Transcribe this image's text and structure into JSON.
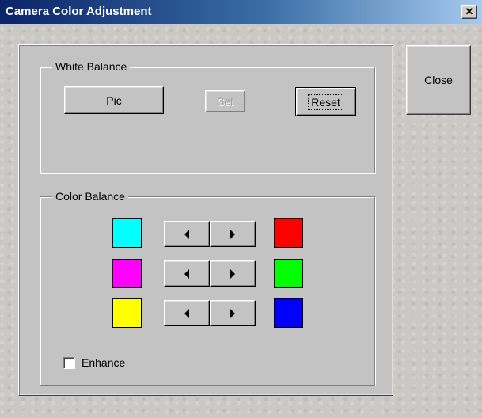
{
  "window": {
    "title": "Camera Color Adjustment",
    "close_glyph": "✕"
  },
  "buttons": {
    "close_label": "Close"
  },
  "white_balance": {
    "label": "White Balance",
    "pic_label": "Pic",
    "set_label": "Set",
    "reset_label": "Reset"
  },
  "color_balance": {
    "label": "Color Balance",
    "rows": [
      {
        "left_color": "#00ffff",
        "right_color": "#ff0000",
        "left_name": "cyan",
        "right_name": "red"
      },
      {
        "left_color": "#ff00ff",
        "right_color": "#00ff00",
        "left_name": "magenta",
        "right_name": "green"
      },
      {
        "left_color": "#ffff00",
        "right_color": "#0000ff",
        "left_name": "yellow",
        "right_name": "blue"
      }
    ],
    "enhance_label": "Enhance",
    "enhance_checked": false
  },
  "icons": {
    "left": "left-arrow-icon",
    "right": "right-arrow-icon"
  }
}
